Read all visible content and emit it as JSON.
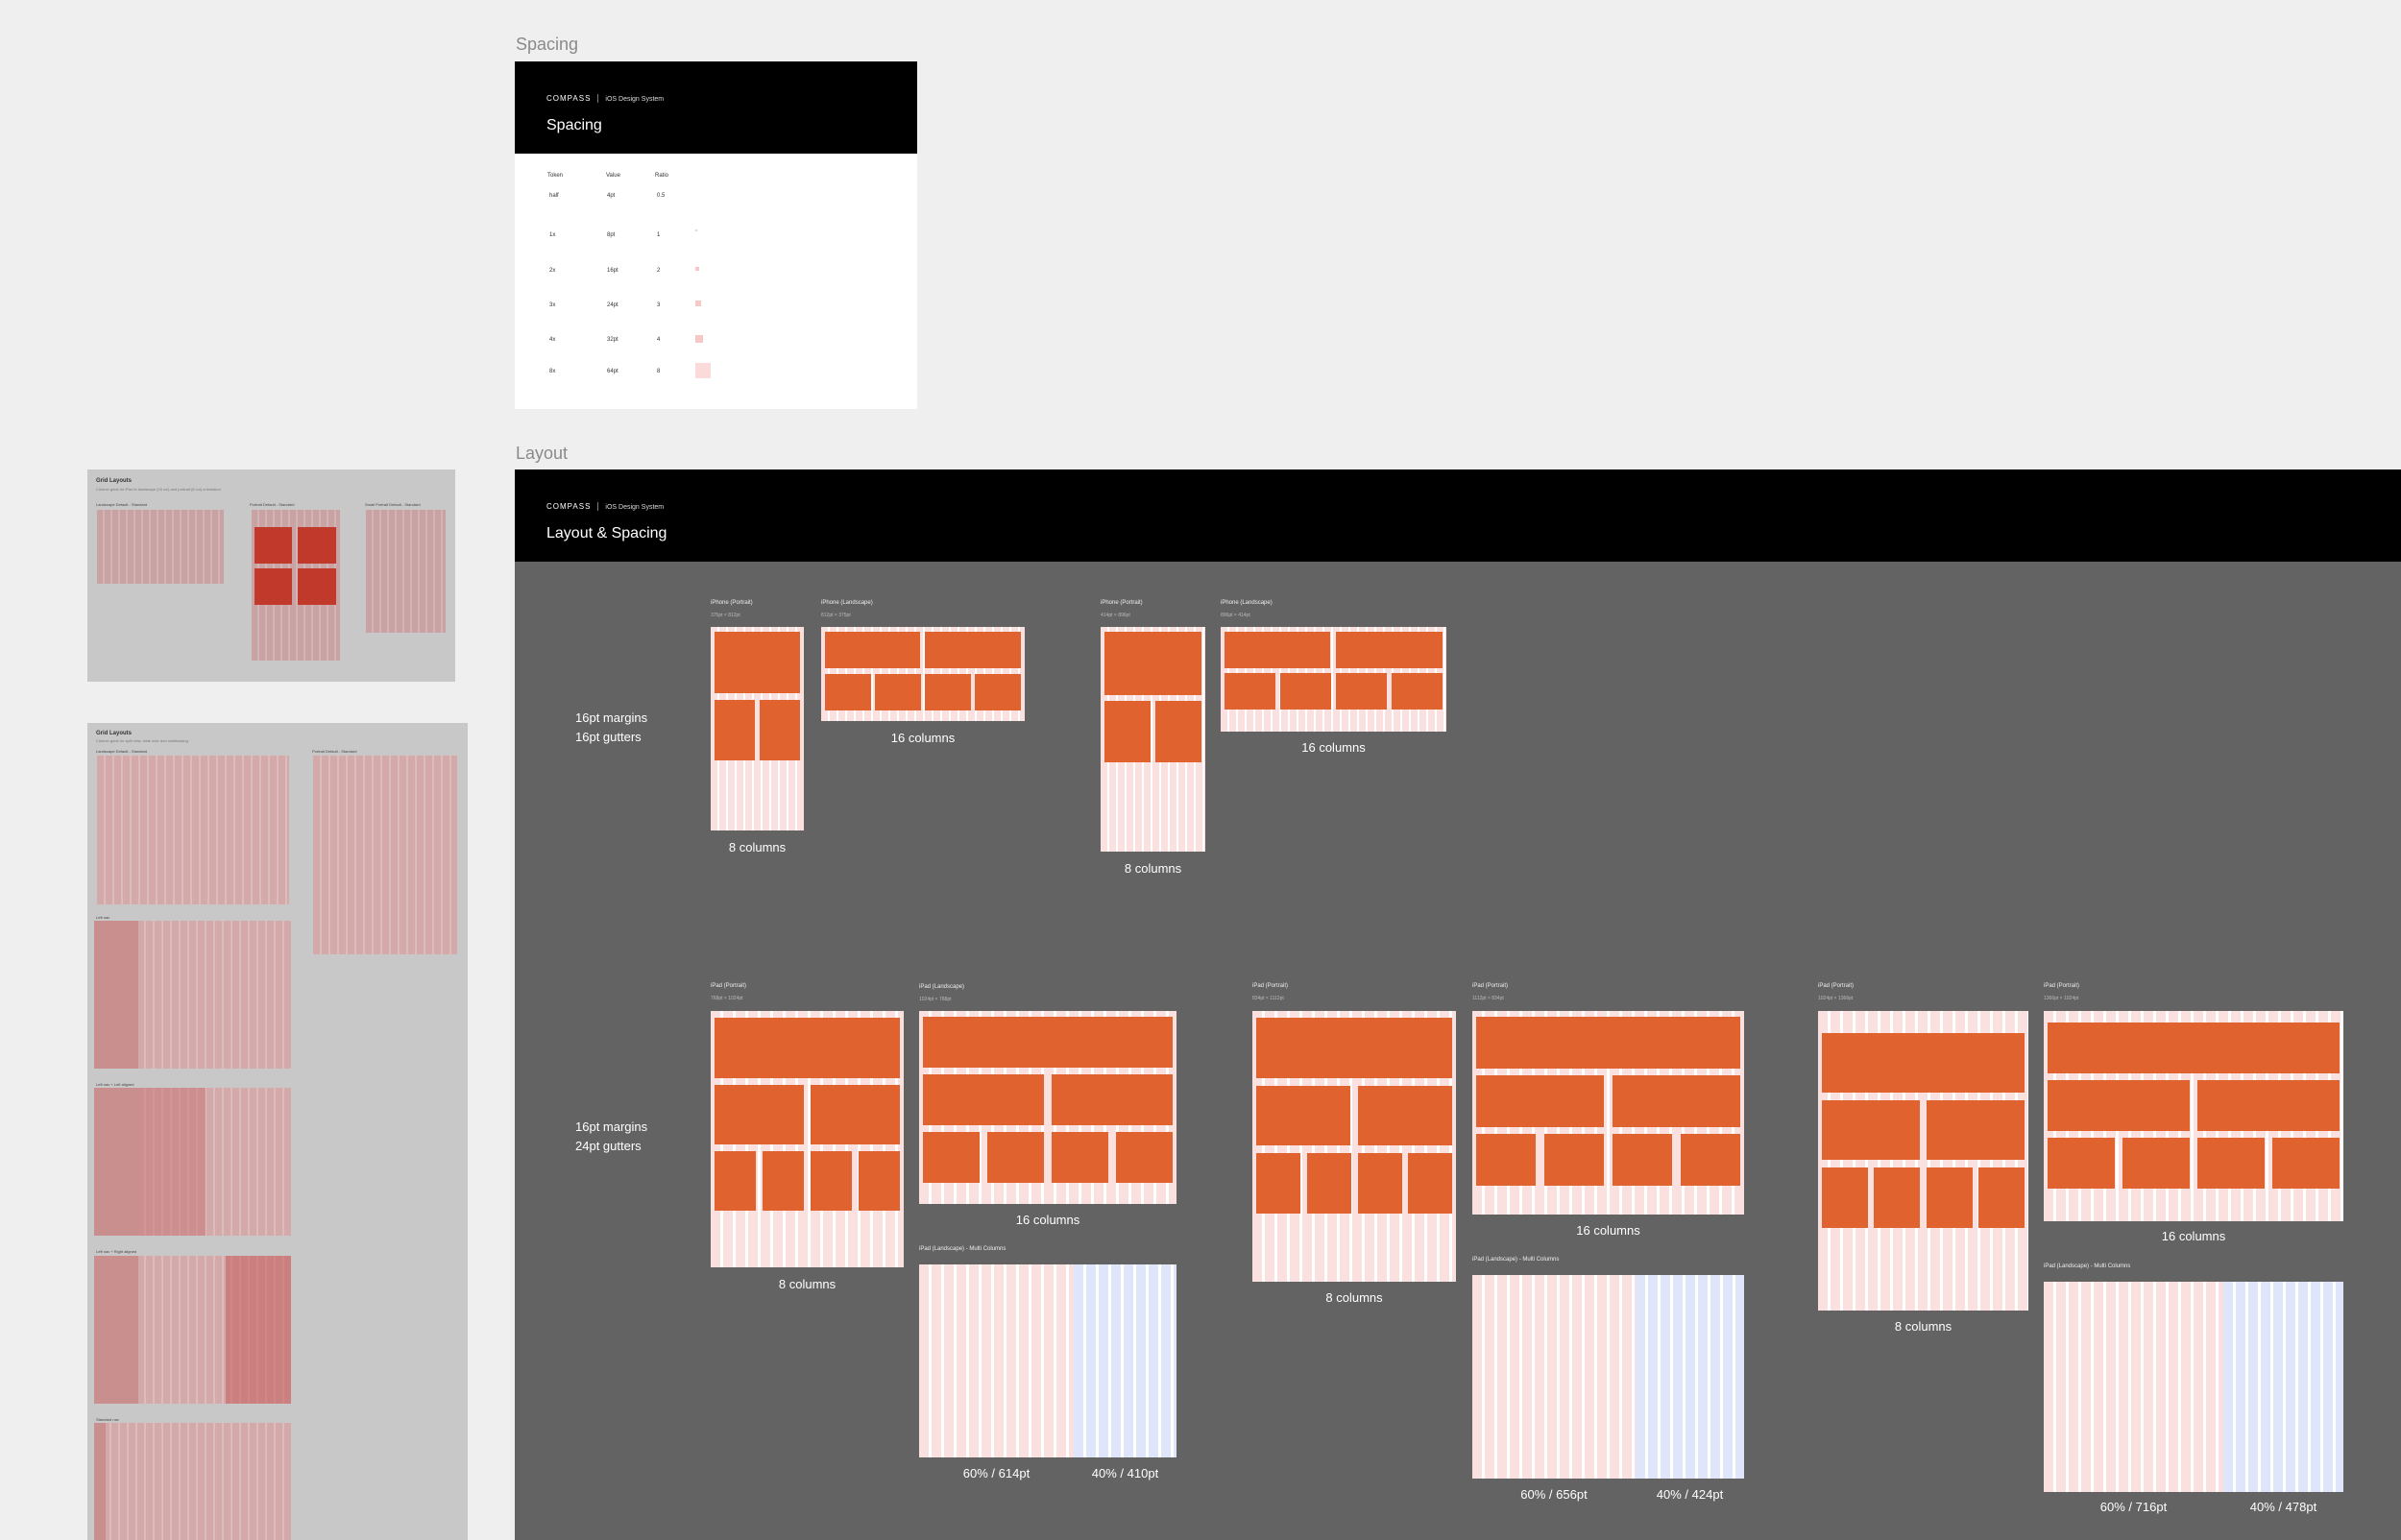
{
  "spacing": {
    "frame_label": "Spacing",
    "brand": "COMPASS",
    "brand_sub": "iOS Design System",
    "title": "Spacing",
    "headers": [
      "Token",
      "Value",
      "Ratio"
    ],
    "rows": [
      {
        "token": "half",
        "value": "4pt",
        "ratio": "0.5"
      },
      {
        "token": "1x",
        "value": "8pt",
        "ratio": "1"
      },
      {
        "token": "2x",
        "value": "16pt",
        "ratio": "2"
      },
      {
        "token": "3x",
        "value": "24pt",
        "ratio": "3"
      },
      {
        "token": "4x",
        "value": "32pt",
        "ratio": "4"
      },
      {
        "token": "8x",
        "value": "64pt",
        "ratio": "8"
      }
    ]
  },
  "layout": {
    "frame_label": "Layout",
    "brand": "COMPASS",
    "brand_sub": "iOS Design System",
    "title": "Layout & Spacing",
    "row1_note": [
      "16pt margins",
      "16pt gutters"
    ],
    "row2_note": [
      "16pt margins",
      "24pt gutters"
    ],
    "iphone": {
      "portrait_label": "iPhone (Portrait)",
      "landscape_label": "iPhone (Landscape)",
      "a_portrait_sub": "375pt × 812pt",
      "a_landscape_sub": "812pt × 375pt",
      "b_portrait_sub": "414pt × 896pt",
      "b_landscape_sub": "896pt × 414pt",
      "caption_8": "8 columns",
      "caption_16": "16 columns"
    },
    "ipad": {
      "portrait_label": "iPad (Portrait)",
      "landscape_label": "iPad (Landscape)",
      "multi_label": "iPad (Landscape) - Multi Columns",
      "a_portrait_sub": "768pt × 1024pt",
      "a_landscape_sub": "1024pt × 768pt",
      "b_portrait_sub": "834pt × 1112pt",
      "b_landscape_sub": "1112pt × 834pt",
      "c_portrait_sub": "1024pt × 1366pt",
      "c_landscape_sub": "1366pt × 1024pt",
      "caption_8": "8 columns",
      "caption_16": "16 columns",
      "a_split": [
        "60% / 614pt",
        "40% / 410pt"
      ],
      "b_split": [
        "60% / 656pt",
        "40% / 424pt"
      ],
      "c_split": [
        "60% / 716pt",
        "40% / 478pt"
      ]
    }
  },
  "grid_thumb_1": {
    "title": "Grid Layouts",
    "subtitle": "Column grids for iPad in landscape (16 col) and portrait (8 col) orientation",
    "labels": [
      "Landscape Default - Standard",
      "Portrait Default - Standard",
      "Small Portrait Default - Standard"
    ]
  },
  "grid_thumb_2": {
    "title": "Grid Layouts",
    "subtitle": "Column grids for split view, slide over and multitasking",
    "labels": [
      "Landscape Default - Standard",
      "Portrait Default - Standard",
      "Left nav",
      "Left nav + Left aligned",
      "Left nav + Right aligned",
      "Standard nav"
    ]
  },
  "colors": {
    "accent": "#e0622e",
    "canvas": "#efefef",
    "board": "#636363"
  }
}
